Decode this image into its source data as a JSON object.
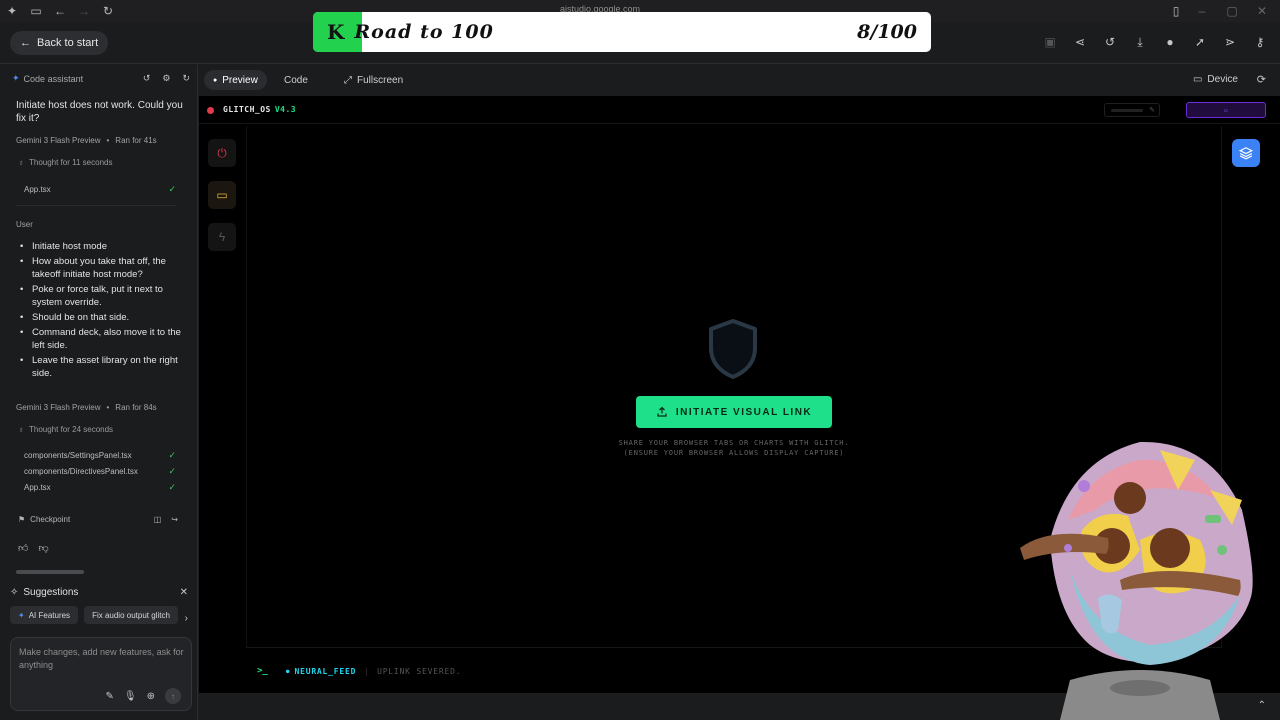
{
  "browser": {
    "url": "aistudio.google.com"
  },
  "header": {
    "back_label": "Back to start"
  },
  "banner": {
    "letter": "K",
    "title": "Road to 100",
    "count": "8/100",
    "progress": 0.08
  },
  "assistant": {
    "title": "Code assistant",
    "message_1": "Initiate host does not work. Could you fix it?",
    "run_1": {
      "model": "Gemini 3 Flash Preview",
      "time": "Ran for 41s"
    },
    "thought_1": "Thought for 11 seconds",
    "files_1": [
      "App.tsx"
    ],
    "user_label": "User",
    "user_items": [
      "Initiate host mode",
      "How about you take that off, the takeoff initiate host mode?",
      "Poke or force talk, put it next to system override.",
      "Should be on that side.",
      "Command deck, also move it to the left side.",
      "Leave the asset library on the right side."
    ],
    "run_2": {
      "model": "Gemini 3 Flash Preview",
      "time": "Ran for 84s"
    },
    "thought_2": "Thought for 24 seconds",
    "files_2": [
      "components/SettingsPanel.tsx",
      "components/DirectivesPanel.tsx",
      "App.tsx"
    ],
    "checkpoint": "Checkpoint",
    "suggestions_title": "Suggestions",
    "chips": [
      "AI Features",
      "Fix audio output glitch"
    ],
    "prompt_placeholder": "Make changes, add new features, ask for anything"
  },
  "tabs": {
    "preview": "Preview",
    "code": "Code",
    "fullscreen": "Fullscreen",
    "device": "Device"
  },
  "app": {
    "os_name": "GLITCH_OS",
    "os_version": "V4.3",
    "init_label": "INITIATE VISUAL LINK",
    "init_sub_1": "SHARE YOUR BROWSER TABS OR CHARTS WITH GLITCH.",
    "init_sub_2": "(ENSURE YOUR BROWSER ALLOWS DISPLAY CAPTURE)",
    "feed_label": "NEURAL_FEED",
    "feed_status": "UPLINK SEVERED.",
    "prompt_symbol": ">_"
  },
  "colors": {
    "accent_green": "#1fe08a",
    "danger": "#e0334a",
    "warn": "#e4b53c",
    "info": "#22d3ee",
    "blue": "#3b82f6"
  }
}
